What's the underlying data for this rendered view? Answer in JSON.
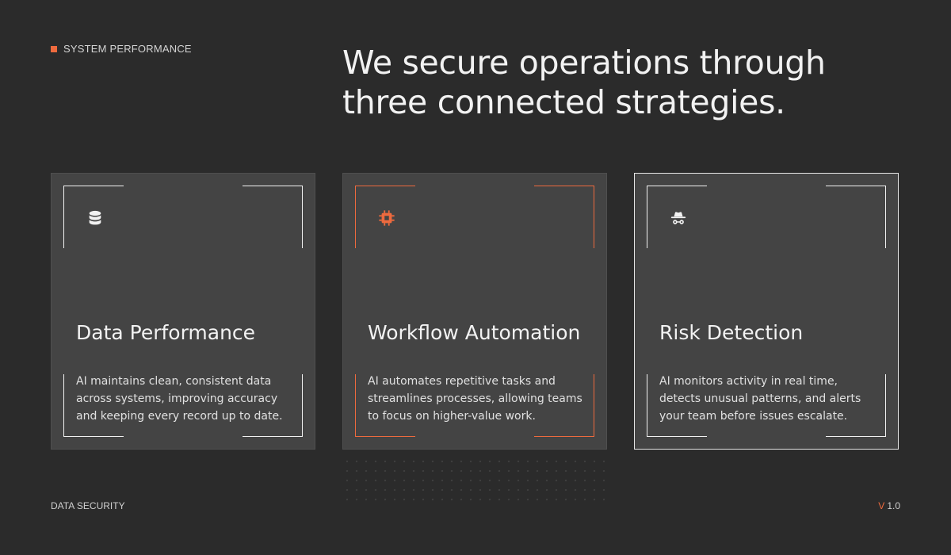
{
  "section_label": "SYSTEM PERFORMANCE",
  "headline": "We secure operations through three connected strategies.",
  "accent_color": "#ee6a3e",
  "cards": [
    {
      "icon": "database-icon",
      "title": "Data Performance",
      "description": "AI maintains clean, consistent data across systems, improving accuracy and keeping every record up to date."
    },
    {
      "icon": "cpu-chip-icon",
      "title": "Workflow Automation",
      "description": "AI automates repetitive tasks and streamlines processes, allowing teams to focus on higher-value work."
    },
    {
      "icon": "incognito-icon",
      "title": "Risk Detection",
      "description": "AI monitors activity in real time, detects unusual patterns, and alerts your team before issues escalate."
    }
  ],
  "footer": {
    "left": "DATA SECURITY",
    "version_prefix": "V",
    "version_number": "1.0"
  }
}
